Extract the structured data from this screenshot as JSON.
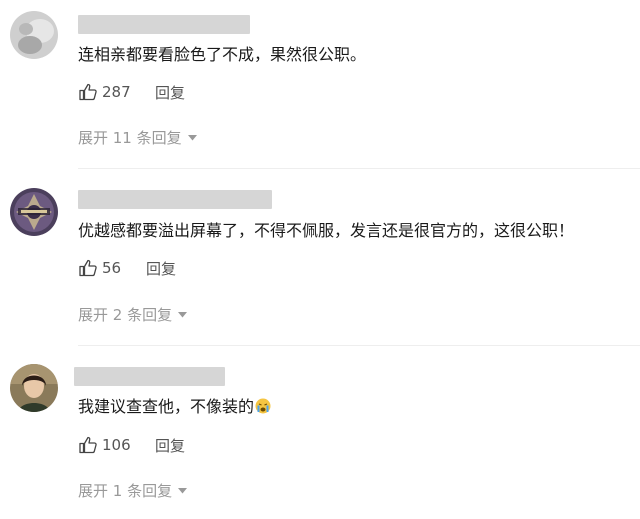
{
  "comments": [
    {
      "text": "连相亲都要看脸色了不成，果然很公职。",
      "likes": "287",
      "reply_label": "回复",
      "expand_label": "展开 11 条回复",
      "avatar_icon": "avatar-photo-icon"
    },
    {
      "text": "优越感都要溢出屏幕了，不得不佩服，发言还是很官方的，这很公职！",
      "likes": "56",
      "reply_label": "回复",
      "expand_label": "展开 2 条回复",
      "avatar_icon": "avatar-emblem-icon"
    },
    {
      "text": "我建议查查他，不像装的",
      "likes": "106",
      "reply_label": "回复",
      "expand_label": "展开 1 条回复",
      "avatar_icon": "avatar-portrait-icon",
      "emoji_icon": "crying-face-icon"
    }
  ],
  "colors": {
    "text": "#1a1a1a",
    "meta": "#555555",
    "expand": "#999999",
    "redacted_name": "#d6d6d6",
    "divider": "#eeeeee"
  }
}
